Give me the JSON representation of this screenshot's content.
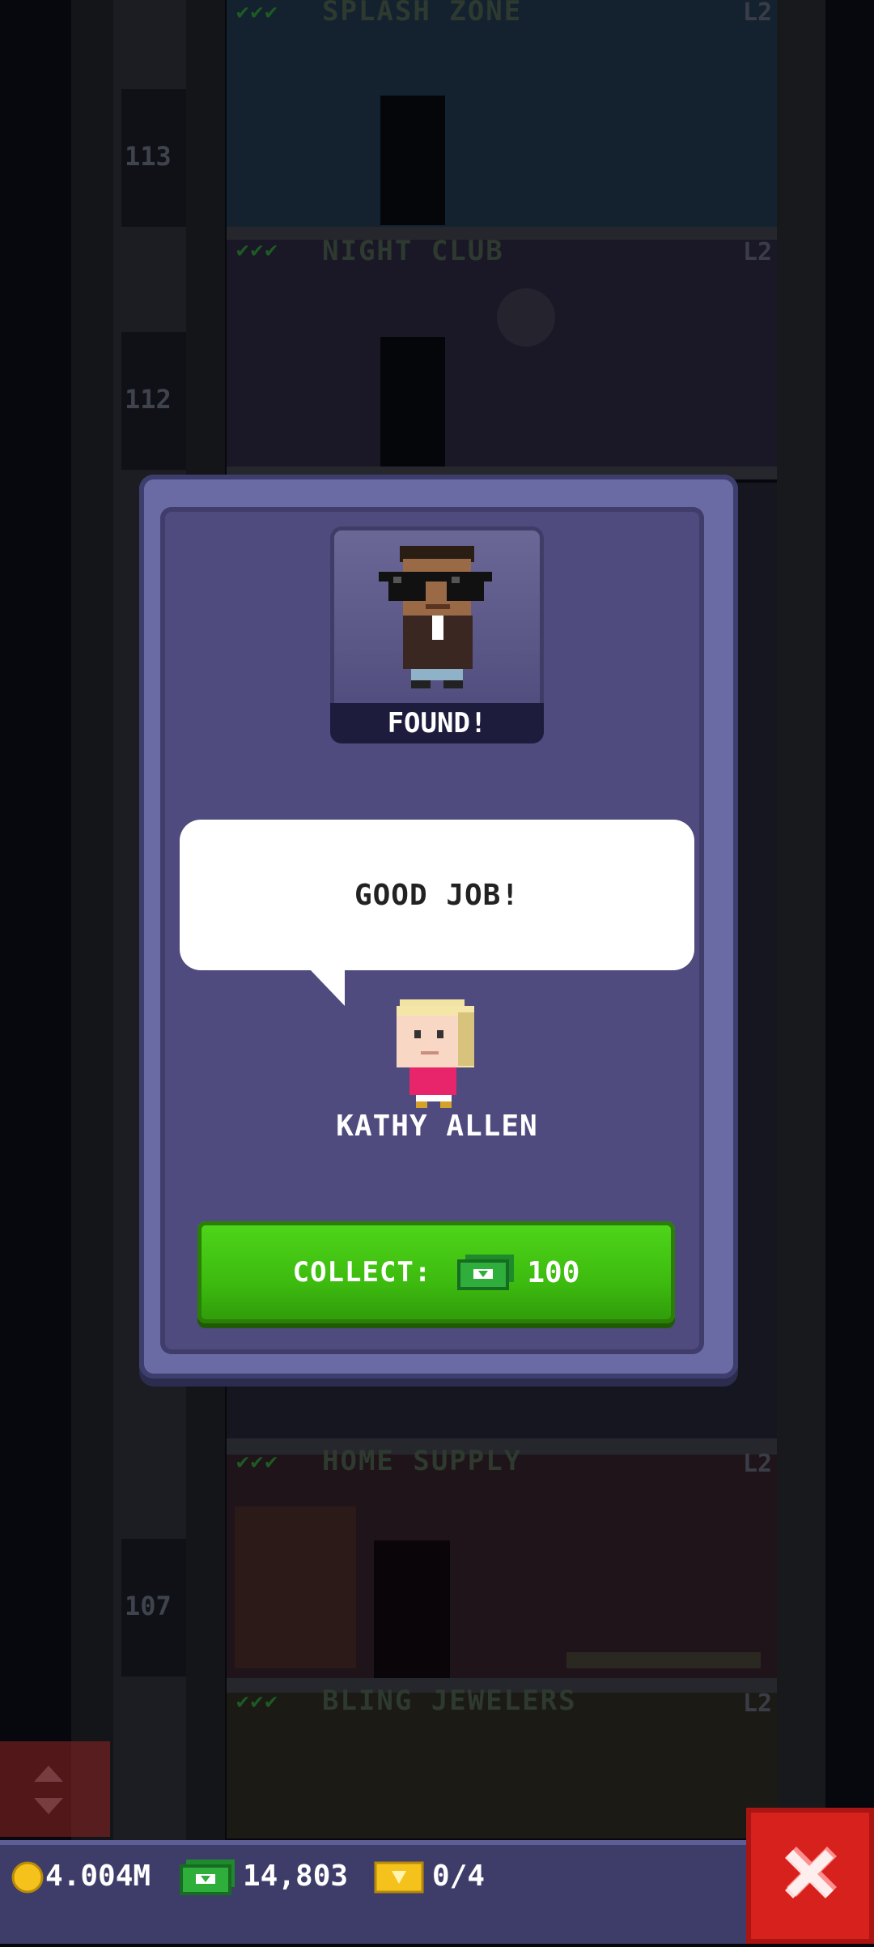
{
  "floors": [
    {
      "title": "SPLASH ZONE",
      "level": "L2",
      "number": "113"
    },
    {
      "title": "NIGHT CLUB",
      "level": "L2",
      "number": "112"
    },
    {
      "title": "HOME SUPPLY",
      "level": "L2",
      "number": "107"
    },
    {
      "title": "BLING JEWELERS",
      "level": "L2",
      "number": ""
    }
  ],
  "modal": {
    "found_label": "FOUND!",
    "speech": "GOOD JOB!",
    "npc_name": "KATHY ALLEN",
    "collect_label": "COLLECT:",
    "collect_amount": "100"
  },
  "hud": {
    "coins": "4.004M",
    "bux": "14,803",
    "tickets": "0/4"
  },
  "colors": {
    "collect_button": "#3dbb0f",
    "close_button": "#d7211d",
    "modal_bg": "#4f4b7f"
  },
  "icons": [
    "coin-icon",
    "bux-icon",
    "ticket-icon",
    "close-icon",
    "elevator-icon",
    "checkmark-icon"
  ]
}
